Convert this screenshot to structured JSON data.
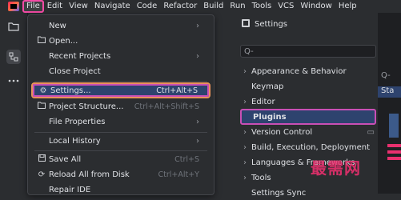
{
  "menubar": {
    "items": [
      "File",
      "Edit",
      "View",
      "Navigate",
      "Code",
      "Refactor",
      "Build",
      "Run",
      "Tools",
      "VCS",
      "Window",
      "Help"
    ]
  },
  "file_menu": {
    "items": [
      {
        "label": "New",
        "icon": "",
        "shortcut": "",
        "arrow": "›"
      },
      {
        "label": "Open...",
        "icon": "folder-icon",
        "shortcut": "",
        "arrow": ""
      },
      {
        "label": "Recent Projects",
        "icon": "",
        "shortcut": "",
        "arrow": "›"
      },
      {
        "label": "Close Project",
        "icon": "",
        "shortcut": "",
        "arrow": ""
      },
      {
        "label": "Settings...",
        "icon": "gear-icon",
        "shortcut": "Ctrl+Alt+S",
        "arrow": ""
      },
      {
        "label": "Project Structure...",
        "icon": "project-structure-icon",
        "shortcut": "Ctrl+Alt+Shift+S",
        "arrow": ""
      },
      {
        "label": "File Properties",
        "icon": "",
        "shortcut": "",
        "arrow": "›"
      },
      {
        "label": "Local History",
        "icon": "",
        "shortcut": "",
        "arrow": "›"
      },
      {
        "label": "Save All",
        "icon": "save-icon",
        "shortcut": "Ctrl+S",
        "arrow": ""
      },
      {
        "label": "Reload All from Disk",
        "icon": "reload-icon",
        "shortcut": "Ctrl+Alt+Y",
        "arrow": ""
      },
      {
        "label": "Repair IDE",
        "icon": "",
        "shortcut": "",
        "arrow": ""
      }
    ]
  },
  "settings": {
    "title": "Settings",
    "search_placeholder": "Q-",
    "tree": [
      {
        "label": "Appearance & Behavior",
        "arrow": "›",
        "badge": ""
      },
      {
        "label": "Keymap",
        "arrow": "",
        "badge": ""
      },
      {
        "label": "Editor",
        "arrow": "›",
        "badge": ""
      },
      {
        "label": "Plugins",
        "arrow": "",
        "badge": ""
      },
      {
        "label": "Version Control",
        "arrow": "›",
        "badge": "▭"
      },
      {
        "label": "Build, Execution, Deployment",
        "arrow": "›",
        "badge": ""
      },
      {
        "label": "Languages & Frameworks",
        "arrow": "›",
        "badge": ""
      },
      {
        "label": "Tools",
        "arrow": "›",
        "badge": ""
      },
      {
        "label": "Settings Sync",
        "arrow": "",
        "badge": ""
      }
    ]
  },
  "right_col": {
    "search": "Q-",
    "tab": "Sta"
  },
  "watermark": {
    "text": "最需网"
  },
  "colors": {
    "highlight_orange": "#e8925a",
    "highlight_pink": "#c94fb5",
    "selection_bg": "#2e436e"
  }
}
